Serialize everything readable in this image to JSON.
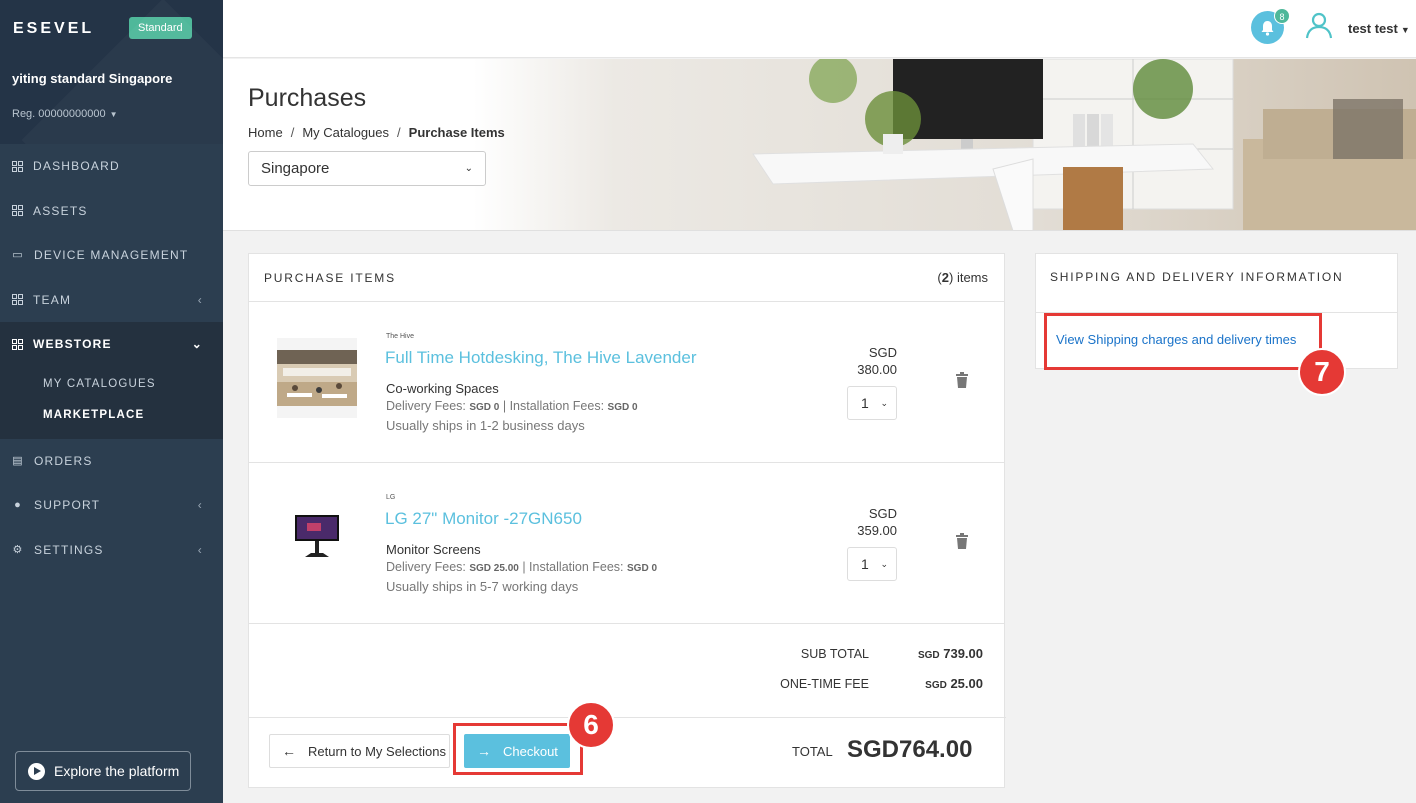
{
  "sidebar": {
    "logo": "ESEVEL",
    "plan_badge": "Standard",
    "org_name": "yiting standard Singapore",
    "org_reg": "Reg. 00000000000",
    "nav": [
      {
        "label": "DASHBOARD"
      },
      {
        "label": "ASSETS"
      },
      {
        "label": "DEVICE MANAGEMENT"
      },
      {
        "label": "TEAM"
      },
      {
        "label": "WEBSTORE"
      },
      {
        "label": "ORDERS"
      },
      {
        "label": "SUPPORT"
      },
      {
        "label": "SETTINGS"
      }
    ],
    "webstore_sub": [
      {
        "label": "MY CATALOGUES"
      },
      {
        "label": "MARKETPLACE"
      }
    ],
    "explore_label": "Explore the platform"
  },
  "topbar": {
    "notification_count": "8",
    "user_name": "test test"
  },
  "header": {
    "title": "Purchases",
    "breadcrumb": [
      "Home",
      "My Catalogues",
      "Purchase Items"
    ],
    "country_selected": "Singapore"
  },
  "purchase": {
    "title": "PURCHASE ITEMS",
    "count": "2",
    "count_suffix": " items",
    "items": [
      {
        "brand": "The Hive",
        "name": "Full Time Hotdesking, The Hive Lavender",
        "category": "Co-working Spaces",
        "delivery_label": "Delivery Fees: ",
        "delivery_value": "SGD 0",
        "install_label": " | Installation Fees: ",
        "install_value": "SGD 0",
        "shipping": "Usually ships in 1-2 business days",
        "currency": "SGD",
        "price": "380.00",
        "qty": "1"
      },
      {
        "brand": "LG",
        "name": "LG 27\" Monitor -27GN650",
        "category": "Monitor Screens",
        "delivery_label": "Delivery Fees: ",
        "delivery_value": "SGD 25.00",
        "install_label": " | Installation Fees: ",
        "install_value": "SGD 0",
        "shipping": "Usually ships in 5-7 working days",
        "currency": "SGD",
        "price": "359.00",
        "qty": "1"
      }
    ],
    "subtotal_label": "SUB TOTAL",
    "subtotal_cur": "SGD",
    "subtotal_value": " 739.00",
    "onetime_label": "ONE-TIME FEE",
    "onetime_cur": "SGD",
    "onetime_value": " 25.00",
    "return_label": "Return to My Selections",
    "checkout_label": "Checkout",
    "total_label": "TOTAL",
    "total_value": "SGD764.00"
  },
  "shipping": {
    "title": "SHIPPING AND DELIVERY INFORMATION",
    "link": "View Shipping charges and delivery times"
  },
  "annotations": {
    "checkout_step": "6",
    "shipping_step": "7"
  },
  "colors": {
    "accent": "#5bc0de",
    "sidebar": "#2c3e50",
    "badge": "#4fb89a",
    "annotation": "#e53935",
    "link": "#1a73c9"
  }
}
